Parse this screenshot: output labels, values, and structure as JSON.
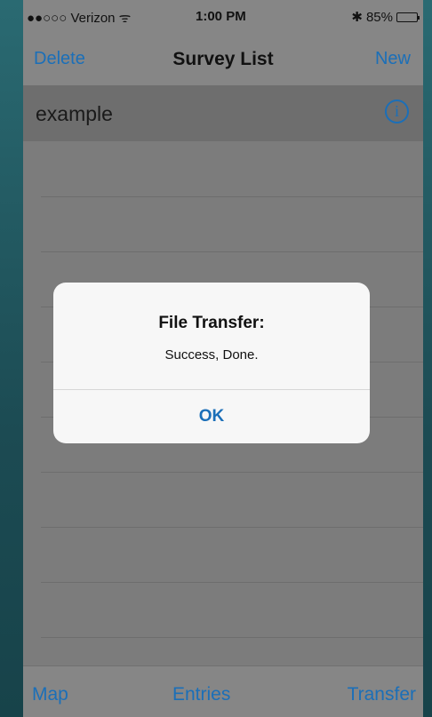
{
  "status": {
    "carrier": "●●○○○ Verizon",
    "time": "1:00 PM",
    "battery": "85%",
    "battery_level": 0.85
  },
  "nav": {
    "delete_label": "Delete",
    "title": "Survey List",
    "new_label": "New"
  },
  "list": {
    "items": [
      {
        "label": "example"
      }
    ]
  },
  "toolbar": {
    "map_label": "Map",
    "entries_label": "Entries",
    "transfer_label": "Transfer"
  },
  "alert": {
    "title": "File Transfer:",
    "message": "Success, Done.",
    "ok_label": "OK"
  },
  "colors": {
    "accent": "#1b6fb8",
    "overlay": "#7c7c7c"
  }
}
